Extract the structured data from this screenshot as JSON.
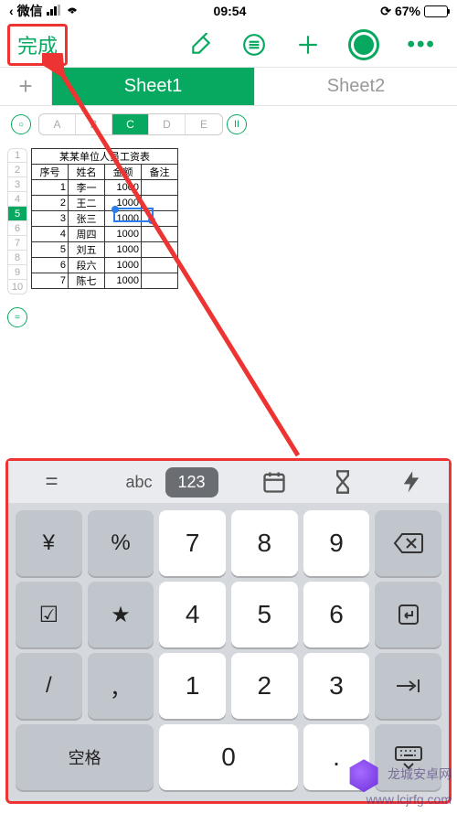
{
  "status": {
    "back_app": "微信",
    "time": "09:54",
    "battery_pct": "67%"
  },
  "toolbar": {
    "done_label": "完成"
  },
  "sheets": {
    "tabs": [
      "Sheet1",
      "Sheet2"
    ],
    "active_index": 0
  },
  "columns": [
    "A",
    "B",
    "C",
    "D",
    "E"
  ],
  "selected_col": "C",
  "row_numbers": [
    "1",
    "2",
    "3",
    "4",
    "5",
    "6",
    "7",
    "8",
    "9",
    "10"
  ],
  "selected_row": "5",
  "table": {
    "title": "某某单位人员工资表",
    "headers": [
      "序号",
      "姓名",
      "金额",
      "备注"
    ],
    "rows": [
      {
        "idx": "1",
        "name": "李一",
        "amount": "1000",
        "note": ""
      },
      {
        "idx": "2",
        "name": "王二",
        "amount": "1000",
        "note": ""
      },
      {
        "idx": "3",
        "name": "张三",
        "amount": "1000",
        "note": ""
      },
      {
        "idx": "4",
        "name": "周四",
        "amount": "1000",
        "note": ""
      },
      {
        "idx": "5",
        "name": "刘五",
        "amount": "1000",
        "note": ""
      },
      {
        "idx": "6",
        "name": "段六",
        "amount": "1000",
        "note": ""
      },
      {
        "idx": "7",
        "name": "陈七",
        "amount": "1000",
        "note": ""
      }
    ]
  },
  "keyboard": {
    "mode_eq": "=",
    "mode_abc": "abc",
    "mode_123": "123",
    "keys": {
      "yen": "¥",
      "pct": "%",
      "k7": "7",
      "k8": "8",
      "k9": "9",
      "chk": "☑",
      "star": "★",
      "k4": "4",
      "k5": "5",
      "k6": "6",
      "slash": "/",
      "comma": "，",
      "k1": "1",
      "k2": "2",
      "k3": "3",
      "space_label": "空格",
      "k0": "0",
      "dot": "."
    }
  },
  "watermark": {
    "line1": "龙城安卓网",
    "line2": "www.lcjrfg.com"
  }
}
